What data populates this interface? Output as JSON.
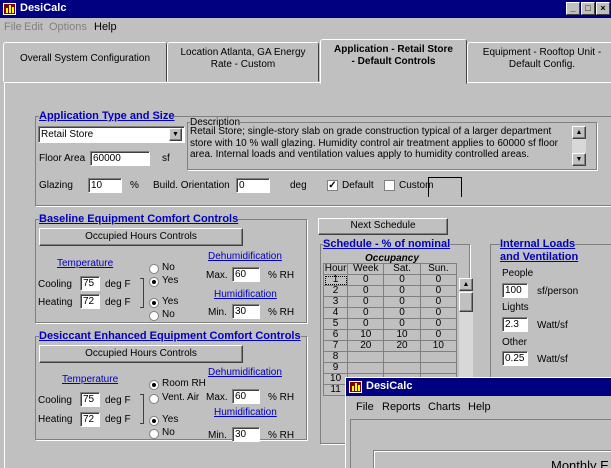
{
  "window": {
    "title": "DesiCalc"
  },
  "menu": {
    "file": "File",
    "edit": "Edit",
    "options": "Options",
    "help": "Help"
  },
  "tabs": {
    "overall": "Overall System Configuration",
    "location_l1": "Location Atlanta, GA Energy",
    "location_l2": "Rate - Custom",
    "application_l1": "Application - Retail Store",
    "application_l2": "- Default Controls",
    "equipment_l1": "Equipment - Rooftop Unit -",
    "equipment_l2": "Default Config."
  },
  "app_type": {
    "header": "Application Type and Size",
    "selected": "Retail Store",
    "floor_area_label": "Floor Area",
    "floor_area": "60000",
    "floor_area_unit": "sf",
    "glazing_label": "Glazing",
    "glazing": "10",
    "glazing_unit": "%",
    "orientation_label": "Build. Orientation",
    "orientation": "0",
    "orientation_unit": "deg"
  },
  "description": {
    "label": "Description",
    "text": "Retail Store; single-story slab on grade construction typical of a larger department store with 10 % wall glazing. Humidity control air treatment applies to 60000 sf floor area. Internal loads and ventilation values apply to humidity controlled areas."
  },
  "mode": {
    "default_label": "Default",
    "custom_label": "Custom"
  },
  "baseline": {
    "header": "Baseline Equipment Comfort Controls",
    "occupied_btn": "Occupied Hours Controls",
    "temperature": "Temperature",
    "cooling_label": "Cooling",
    "cooling": "75",
    "heating_label": "Heating",
    "heating": "72",
    "deg_unit": "deg F",
    "no": "No",
    "yes": "Yes",
    "dehum_label": "Dehumidification",
    "dehum_max_label": "Max.",
    "dehum_max": "60",
    "hum_label": "Humidification",
    "hum_min_label": "Min.",
    "hum_min": "30",
    "rh_unit": "% RH"
  },
  "desiccant": {
    "header": "Desiccant Enhanced Equipment Comfort Controls",
    "occupied_btn": "Occupied Hours Controls",
    "temperature": "Temperature",
    "cooling_label": "Cooling",
    "cooling": "75",
    "heating_label": "Heating",
    "heating": "72",
    "deg_unit": "deg F",
    "room_rh": "Room RH",
    "vent_air": "Vent. Air",
    "yes": "Yes",
    "no": "No",
    "dehum_label": "Dehumidification",
    "dehum_max_label": "Max.",
    "dehum_max": "60",
    "hum_label": "Humidification",
    "hum_min_label": "Min.",
    "hum_min": "30",
    "rh_unit": "% RH"
  },
  "schedule": {
    "next_btn": "Next Schedule",
    "header": "Schedule  -  % of nominal",
    "occupancy": "Occupancy",
    "cols": [
      "Hour",
      "Week",
      "Sat.",
      "Sun."
    ],
    "rows": [
      [
        "1",
        "0",
        "0",
        "0"
      ],
      [
        "2",
        "0",
        "0",
        "0"
      ],
      [
        "3",
        "0",
        "0",
        "0"
      ],
      [
        "4",
        "0",
        "0",
        "0"
      ],
      [
        "5",
        "0",
        "0",
        "0"
      ],
      [
        "6",
        "10",
        "10",
        "0"
      ],
      [
        "7",
        "20",
        "20",
        "10"
      ],
      [
        "8",
        "",
        "",
        " "
      ],
      [
        "9",
        "",
        "",
        ""
      ],
      [
        "10",
        "",
        "",
        ""
      ],
      [
        "11",
        "",
        "",
        ""
      ]
    ]
  },
  "internal": {
    "header_l1": "Internal Loads",
    "header_l2": "and Ventilation",
    "people_label": "People",
    "people": "100",
    "people_unit": "sf/person",
    "lights_label": "Lights",
    "lights": "2.3",
    "lights_unit": "Watt/sf",
    "other_label": "Other",
    "other": "0.25",
    "other_unit": "Watt/sf"
  },
  "child": {
    "title": "DesiCalc",
    "menu": [
      "File",
      "Reports",
      "Charts",
      "Help"
    ],
    "content_title": "Monthly E"
  }
}
